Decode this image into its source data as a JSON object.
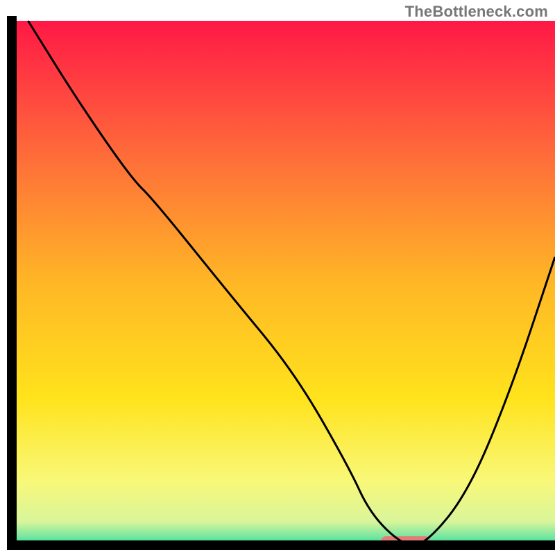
{
  "watermark": "TheBottleneck.com",
  "chart_data": {
    "type": "line",
    "title": "",
    "xlabel": "",
    "ylabel": "",
    "xlim": [
      0,
      100
    ],
    "ylim": [
      0,
      100
    ],
    "grid": false,
    "legend": false,
    "series": [
      {
        "name": "curve",
        "x": [
          3,
          12,
          22,
          26,
          40,
          52,
          62,
          66,
          72,
          76,
          84,
          92,
          100
        ],
        "values": [
          100,
          85,
          70,
          66,
          48,
          33,
          15,
          6,
          0,
          0,
          10,
          30,
          55
        ]
      }
    ],
    "highlight": {
      "x_range": [
        68,
        77
      ],
      "color": "#e27c75"
    },
    "background_gradient": {
      "stops": [
        {
          "offset": 0.0,
          "color": "#ff1846"
        },
        {
          "offset": 0.25,
          "color": "#ff6a3a"
        },
        {
          "offset": 0.5,
          "color": "#ffb726"
        },
        {
          "offset": 0.72,
          "color": "#ffe31c"
        },
        {
          "offset": 0.88,
          "color": "#f8f87a"
        },
        {
          "offset": 0.955,
          "color": "#d9f59a"
        },
        {
          "offset": 0.985,
          "color": "#71e6a0"
        },
        {
          "offset": 1.0,
          "color": "#17d98e"
        }
      ]
    },
    "axis_color": "#000000",
    "line_color": "#000000",
    "line_width": 3
  }
}
